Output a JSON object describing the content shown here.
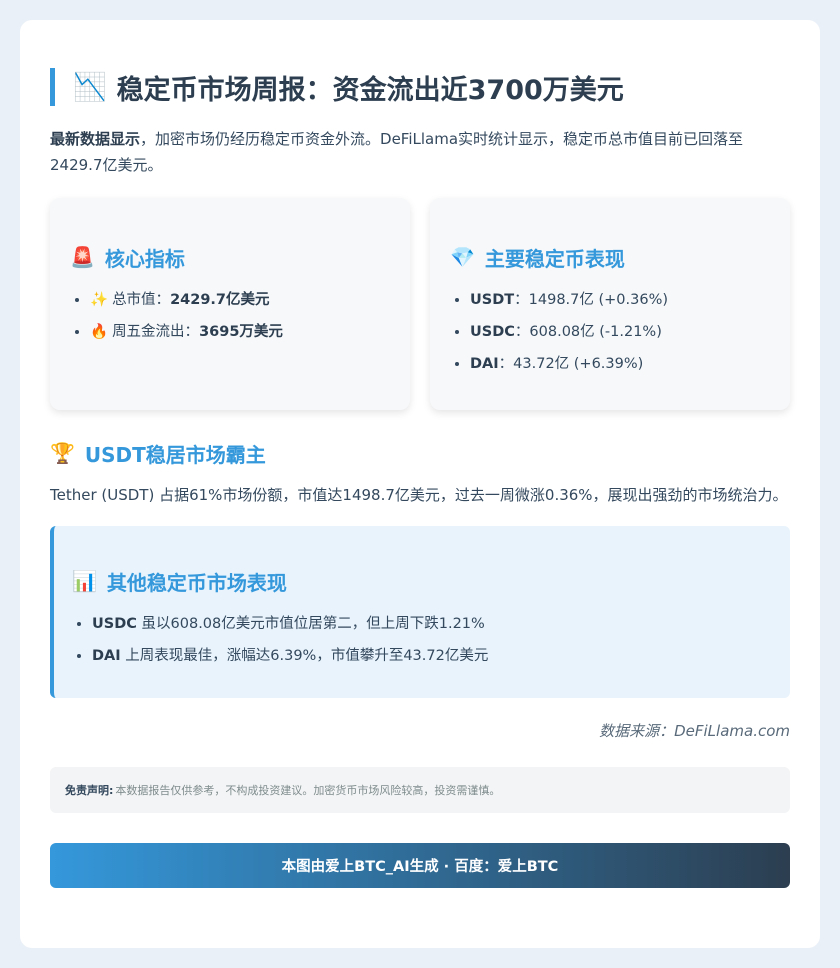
{
  "header": {
    "icon": "📉",
    "title": "稳定币市场周报：资金流出近3700万美元"
  },
  "intro": {
    "lead": "最新数据显示",
    "text": "，加密市场仍经历稳定币资金外流。DeFiLlama实时统计显示，稳定币总市值目前已回落至2429.7亿美元。"
  },
  "core_metrics": {
    "icon": "🚨",
    "title": "核心指标",
    "items": [
      {
        "icon": "✨",
        "label": "总市值：",
        "value": "2429.7亿美元"
      },
      {
        "icon": "🔥",
        "label": "周五金流出：",
        "value": "3695万美元"
      }
    ]
  },
  "main_stablecoins": {
    "icon": "💎",
    "title": "主要稳定币表现",
    "items": [
      {
        "name": "USDT",
        "sep": "：",
        "value": "1498.7亿 (+0.36%)"
      },
      {
        "name": "USDC",
        "sep": "：",
        "value": "608.08亿 (-1.21%)"
      },
      {
        "name": "DAI",
        "sep": "：",
        "value": "43.72亿 (+6.39%)"
      }
    ]
  },
  "usdt_section": {
    "icon": "🏆",
    "title": "USDT稳居市场霸主",
    "text": "Tether (USDT) 占据61%市场份额，市值达1498.7亿美元，过去一周微涨0.36%，展现出强劲的市场统治力。"
  },
  "other_section": {
    "icon": "📊",
    "title": "其他稳定币市场表现",
    "items": [
      {
        "name": "USDC",
        "text": " 虽以608.08亿美元市值位居第二，但上周下跌1.21%"
      },
      {
        "name": "DAI",
        "text": " 上周表现最佳，涨幅达6.39%，市值攀升至43.72亿美元"
      }
    ]
  },
  "source": "数据来源：DeFiLlama.com",
  "disclaimer": {
    "label": "免责声明:",
    "text": " 本数据报告仅供参考，不构成投资建议。加密货币市场风险较高，投资需谨慎。"
  },
  "footer": "本图由爱上BTC_AI生成 · 百度：爱上BTC",
  "colors": {
    "accent": "#3498db",
    "dark": "#2c3e50",
    "info_bg": "#e8f3fc"
  }
}
